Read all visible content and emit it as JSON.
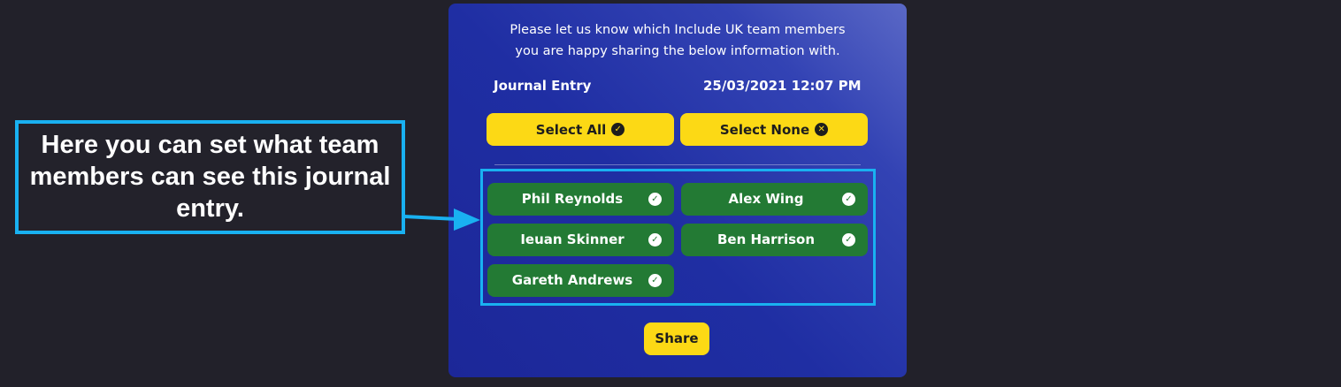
{
  "share_panel": {
    "intro": "Please let us know which Include UK team members\nyou are happy sharing the below information with.",
    "entry_label": "Journal Entry",
    "entry_datetime": "25/03/2021 12:07 PM",
    "select_all_label": "Select All",
    "select_none_label": "Select None",
    "members": [
      {
        "name": "Phil Reynolds",
        "selected": true
      },
      {
        "name": "Alex Wing",
        "selected": true
      },
      {
        "name": "Ieuan Skinner",
        "selected": true
      },
      {
        "name": "Ben Harrison",
        "selected": true
      },
      {
        "name": "Gareth Andrews",
        "selected": true
      }
    ],
    "share_label": "Share"
  },
  "annotation": {
    "callout_text": "Here you can set what team members can see this journal entry.",
    "accent_color": "#19b1f1"
  },
  "icons": {
    "select_all": "check-circle-icon",
    "select_none": "x-circle-icon",
    "member_selected": "check-circle-icon"
  },
  "colors": {
    "background": "#22212a",
    "panel": "#1f2ea3",
    "button_yellow": "#fcd915",
    "member_green": "#237a34"
  }
}
